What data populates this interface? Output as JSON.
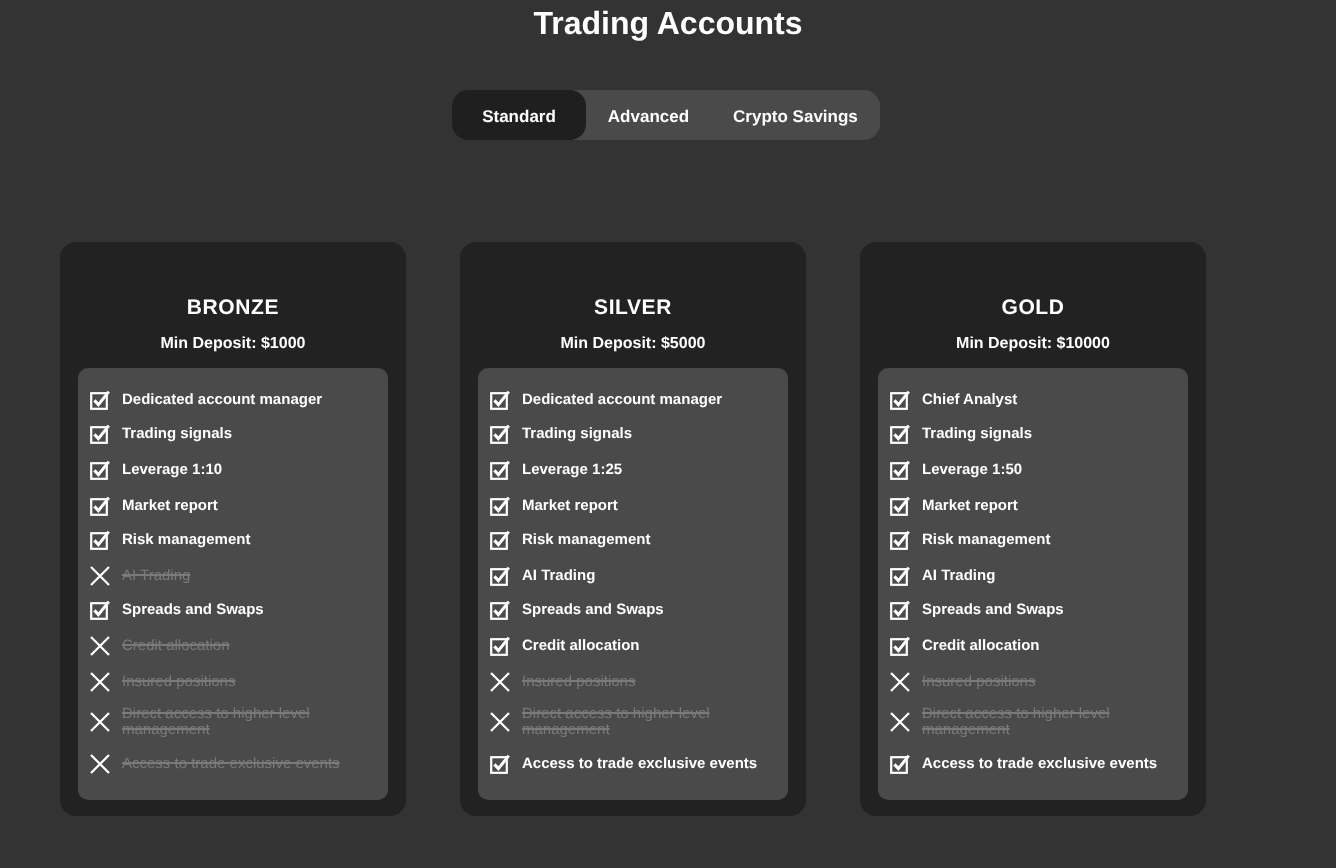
{
  "title": "Trading Accounts",
  "tabs": [
    {
      "label": "Standard",
      "selected": true
    },
    {
      "label": "Advanced",
      "selected": false
    },
    {
      "label": "Crypto Savings",
      "selected": false
    }
  ],
  "plans": [
    {
      "name": "BRONZE",
      "min_deposit": "Min Deposit: $1000",
      "features": [
        {
          "label": "Dedicated account manager",
          "included": true
        },
        {
          "label": "Trading signals",
          "included": true
        },
        {
          "label": "Leverage 1:10",
          "included": true
        },
        {
          "label": "Market report",
          "included": true
        },
        {
          "label": "Risk management",
          "included": true
        },
        {
          "label": "AI Trading",
          "included": false
        },
        {
          "label": "Spreads and Swaps",
          "included": true
        },
        {
          "label": "Credit allocation",
          "included": false
        },
        {
          "label": "Insured positions",
          "included": false
        },
        {
          "label": "Direct access to higher level management",
          "included": false
        },
        {
          "label": "Access to trade exclusive events",
          "included": false
        }
      ]
    },
    {
      "name": "SILVER",
      "min_deposit": "Min Deposit: $5000",
      "features": [
        {
          "label": "Dedicated account manager",
          "included": true
        },
        {
          "label": "Trading signals",
          "included": true
        },
        {
          "label": "Leverage 1:25",
          "included": true
        },
        {
          "label": "Market report",
          "included": true
        },
        {
          "label": "Risk management",
          "included": true
        },
        {
          "label": "AI Trading",
          "included": true
        },
        {
          "label": "Spreads and Swaps",
          "included": true
        },
        {
          "label": "Credit allocation",
          "included": true
        },
        {
          "label": "Insured positions",
          "included": false
        },
        {
          "label": "Direct access to higher level management",
          "included": false
        },
        {
          "label": "Access to trade exclusive events",
          "included": true
        }
      ]
    },
    {
      "name": "GOLD",
      "min_deposit": "Min Deposit: $10000",
      "features": [
        {
          "label": "Chief Analyst",
          "included": true
        },
        {
          "label": "Trading signals",
          "included": true
        },
        {
          "label": "Leverage 1:50",
          "included": true
        },
        {
          "label": "Market report",
          "included": true
        },
        {
          "label": "Risk management",
          "included": true
        },
        {
          "label": "AI Trading",
          "included": true
        },
        {
          "label": "Spreads and Swaps",
          "included": true
        },
        {
          "label": "Credit allocation",
          "included": true
        },
        {
          "label": "Insured positions",
          "included": false
        },
        {
          "label": "Direct access to higher level management",
          "included": false
        },
        {
          "label": "Access to trade exclusive events",
          "included": true
        }
      ]
    }
  ]
}
